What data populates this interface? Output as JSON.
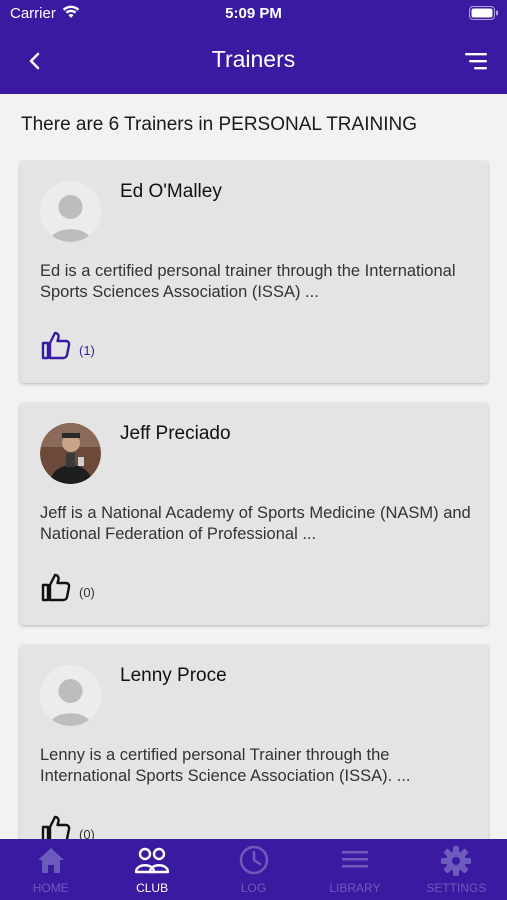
{
  "status_bar": {
    "carrier": "Carrier",
    "time": "5:09 PM"
  },
  "header": {
    "title": "Trainers"
  },
  "summary": "There are 6 Trainers in PERSONAL TRAINING",
  "trainers": [
    {
      "name": "Ed O'Malley",
      "description": "Ed is a certified personal trainer through the International Sports Sciences Association (ISSA) ...",
      "likes": "(1)",
      "liked": true
    },
    {
      "name": "Jeff Preciado",
      "description": "Jeff is a National Academy of Sports Medicine (NASM) and National Federation of Professional ...",
      "likes": "(0)",
      "liked": false
    },
    {
      "name": "Lenny Proce",
      "description": "Lenny is a certified personal Trainer through the International Sports Science Association (ISSA). ...",
      "likes": "(0)",
      "liked": false
    }
  ],
  "tabs": [
    {
      "label": "HOME",
      "icon": "home-icon",
      "active": false
    },
    {
      "label": "CLUB",
      "icon": "people-icon",
      "active": true
    },
    {
      "label": "LOG",
      "icon": "clock-icon",
      "active": false
    },
    {
      "label": "LIBRARY",
      "icon": "list-icon",
      "active": false
    },
    {
      "label": "SETTINGS",
      "icon": "gear-icon",
      "active": false
    }
  ],
  "colors": {
    "brand": "#3a1aa0",
    "tab_inactive": "#6c5bbd",
    "card_bg": "#e4e4e4",
    "like_active": "#3a1aa0"
  }
}
